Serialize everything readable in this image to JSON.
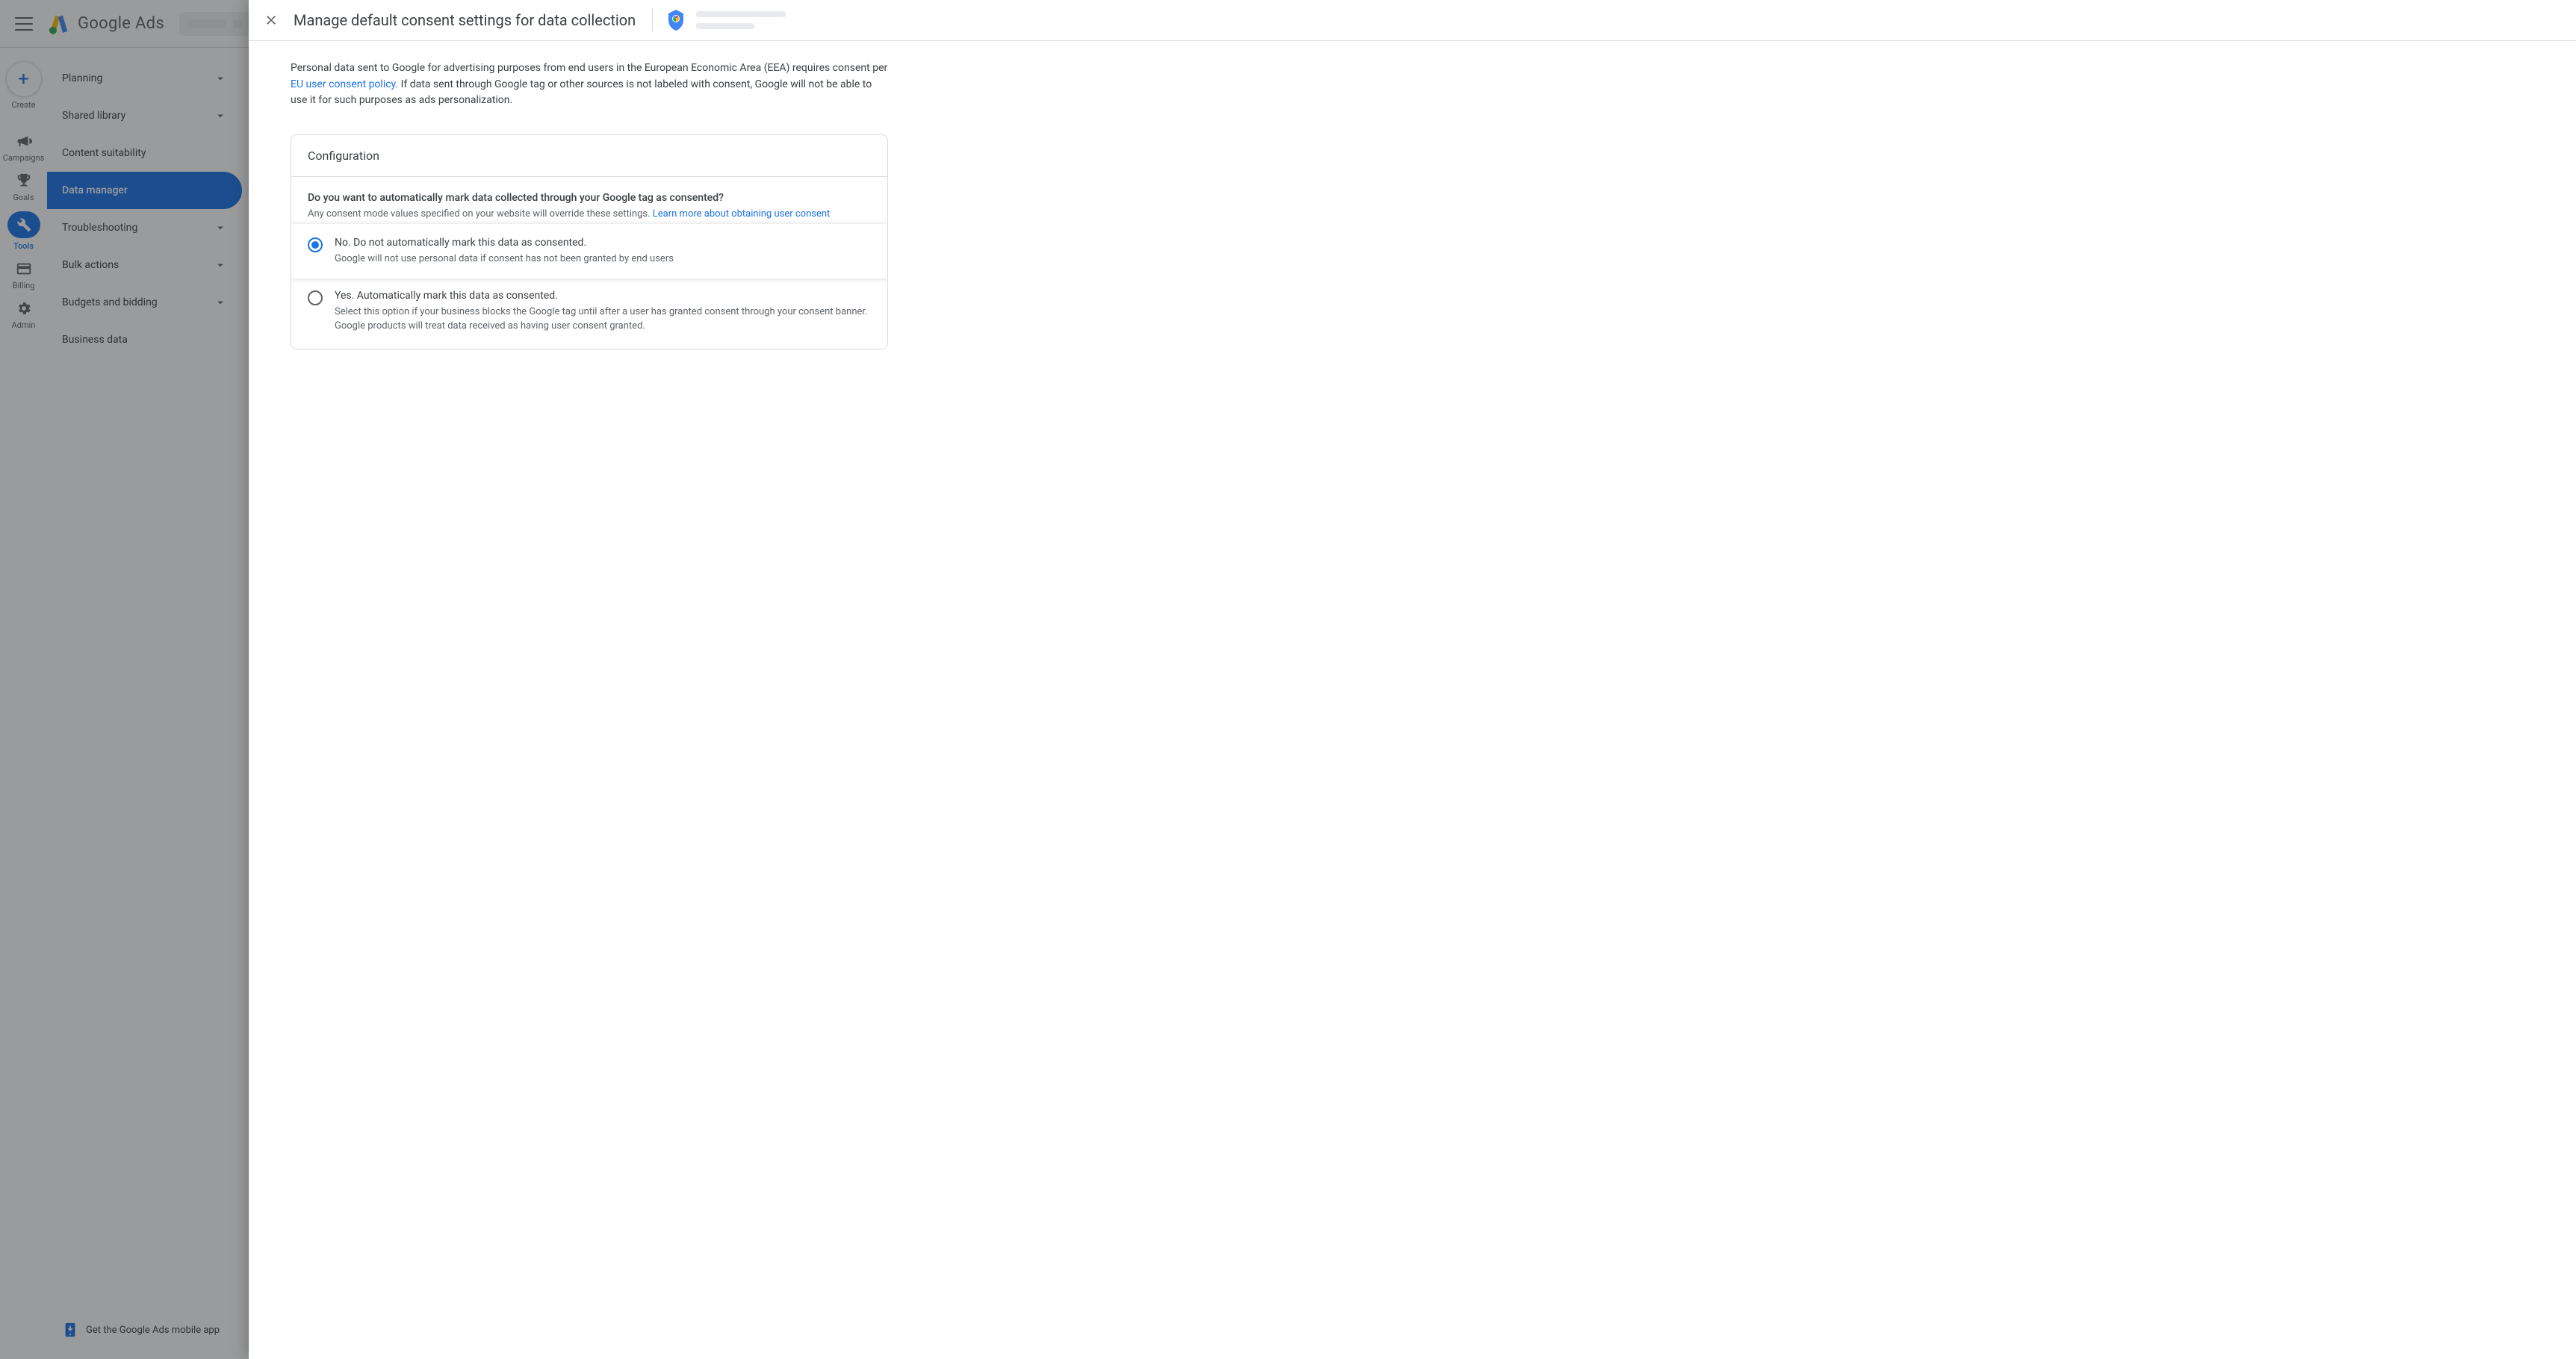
{
  "header": {
    "product_name": "Google Ads"
  },
  "rail": {
    "create_label": "Create",
    "items": [
      {
        "id": "campaigns",
        "label": "Campaigns",
        "icon": "bullhorn"
      },
      {
        "id": "goals",
        "label": "Goals",
        "icon": "trophy"
      },
      {
        "id": "tools",
        "label": "Tools",
        "icon": "wrench",
        "active": true
      },
      {
        "id": "billing",
        "label": "Billing",
        "icon": "card"
      },
      {
        "id": "admin",
        "label": "Admin",
        "icon": "gear"
      }
    ]
  },
  "sidenav": {
    "items": [
      {
        "label": "Planning",
        "expandable": true
      },
      {
        "label": "Shared library",
        "expandable": true
      },
      {
        "label": "Content suitability",
        "expandable": false
      },
      {
        "label": "Data manager",
        "expandable": false,
        "selected": true
      },
      {
        "label": "Troubleshooting",
        "expandable": true
      },
      {
        "label": "Bulk actions",
        "expandable": true
      },
      {
        "label": "Budgets and bidding",
        "expandable": true
      },
      {
        "label": "Business data",
        "expandable": false
      }
    ],
    "footer_label": "Get the Google Ads mobile app"
  },
  "modal": {
    "title": "Manage default consent settings for data collection",
    "intro_pre": "Personal data sent to Google for advertising purposes from end users in the European Economic Area (EEA) requires consent per ",
    "intro_link": "EU user consent policy",
    "intro_post": ". If data sent through Google tag or other sources is not labeled with consent, Google will not be able to use it for such purposes as ads personalization.",
    "card": {
      "title": "Configuration",
      "question": "Do you want to automatically mark data collected through your Google tag as consented?",
      "sub_pre": "Any consent mode values specified on your website will override these settings. ",
      "sub_link": "Learn more about obtaining user consent",
      "options": [
        {
          "id": "no",
          "label": "No. Do not automatically mark this data as consented.",
          "desc": "Google will not use personal data if consent has not been granted by end users",
          "selected": true
        },
        {
          "id": "yes",
          "label": "Yes. Automatically mark this data as consented.",
          "desc": "Select this option if your business blocks the Google tag until after a user has granted consent through your consent banner. Google products will treat data received as having user consent granted.",
          "selected": false
        }
      ]
    }
  }
}
